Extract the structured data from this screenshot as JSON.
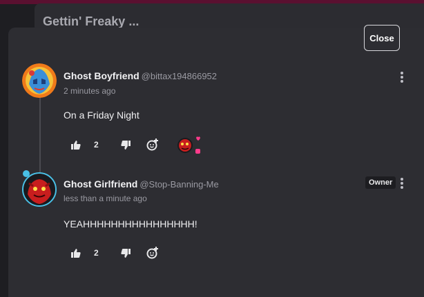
{
  "background": {
    "title": "Gettin' Freaky ..."
  },
  "modal": {
    "close_label": "Close"
  },
  "comments": [
    {
      "author": "Ghost Boyfriend",
      "handle": "@bittax194866952",
      "time": "2 minutes ago",
      "text": "On a Friday Night",
      "likes": "2",
      "has_reaction": true
    },
    {
      "author": "Ghost Girlfriend",
      "handle": "@Stop-Banning-Me",
      "time": "less than a minute ago",
      "text": "YEAHHHHHHHHHHHHHHHH!",
      "likes": "2",
      "badge": "Owner"
    }
  ],
  "colors": {
    "page_bg": "#1e1e22",
    "modal_bg": "#2d2d32",
    "accent_top": "#5a1030"
  },
  "icons": [
    "thumbs-up-icon",
    "thumbs-down-icon",
    "add-reaction-icon",
    "kebab-menu-icon",
    "heart-icon"
  ]
}
